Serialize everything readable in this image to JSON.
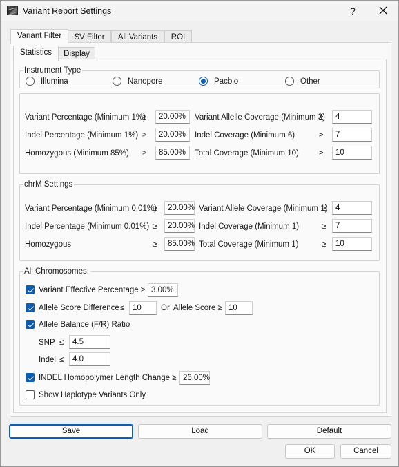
{
  "window": {
    "title": "Variant Report Settings",
    "help_label": "?",
    "close_icon": "close-icon"
  },
  "tabs": [
    "Variant Filter",
    "SV Filter",
    "All Variants",
    "ROI"
  ],
  "subtabs": [
    "Statistics",
    "Display"
  ],
  "instrument": {
    "title": "Instrument Type",
    "options": [
      "Illumina",
      "Nanopore",
      "Pacbio",
      "Other"
    ],
    "selected": "Pacbio"
  },
  "stats": {
    "rows": [
      {
        "left_label": "Variant Percentage (Minimum 1%)",
        "left_op": "≥",
        "left_value": "20.00%",
        "right_label": "Variant Allelle Coverage (Minimum 3)",
        "right_op": "≥",
        "right_value": "4"
      },
      {
        "left_label": "Indel Percentage (Minimum 1%)",
        "left_op": "≥",
        "left_value": "20.00%",
        "right_label": "Indel Coverage (Minimum 6)",
        "right_op": "≥",
        "right_value": "7"
      },
      {
        "left_label": "Homozygous (Minimum 85%)",
        "left_op": "≥",
        "left_value": "85.00%",
        "right_label": "Total Coverage (Minimum 10)",
        "right_op": "≥",
        "right_value": "10"
      }
    ]
  },
  "chrm": {
    "title": "chrM Settings",
    "rows": [
      {
        "left_label": "Variant Percentage (Minimum 0.01%)",
        "left_op": "≥",
        "left_value": "20.00%",
        "right_label": "Variant Allele Coverage (Minimum 1)",
        "right_op": "≥",
        "right_value": "4"
      },
      {
        "left_label": "Indel Percentage (Minimum 0.01%)",
        "left_op": "≥",
        "left_value": "20.00%",
        "right_label": "Indel Coverage (Minimum 1)",
        "right_op": "≥",
        "right_value": "7"
      },
      {
        "left_label": "Homozygous",
        "left_op": "≥",
        "left_value": "85.00%",
        "right_label": "Total Coverage (Minimum 1)",
        "right_op": "≥",
        "right_value": "10"
      }
    ]
  },
  "allchrom": {
    "title": "All Chromosomes:",
    "effective": {
      "label": "Variant Effective Percentage ≥",
      "value": "3.00%",
      "checked": true
    },
    "allele_score": {
      "label": "Allele Score Difference",
      "op": "≤",
      "value": "10",
      "or_label": "Or",
      "score_label": "Allele Score ≥",
      "score_value": "10",
      "checked": true
    },
    "balance": {
      "label": "Allele Balance (F/R) Ratio",
      "checked": true
    },
    "snp": {
      "label": "SNP",
      "op": "≤",
      "value": "4.5"
    },
    "indel": {
      "label": "Indel",
      "op": "≤",
      "value": "4.0"
    },
    "homopolymer": {
      "label": "INDEL Homopolymer Length Change ≥",
      "value": "26.00%",
      "checked": true
    },
    "haplotype": {
      "label": "Show Haplotype Variants Only",
      "checked": false
    }
  },
  "buttons": {
    "save": "Save",
    "load": "Load",
    "default": "Default",
    "ok": "OK",
    "cancel": "Cancel"
  }
}
